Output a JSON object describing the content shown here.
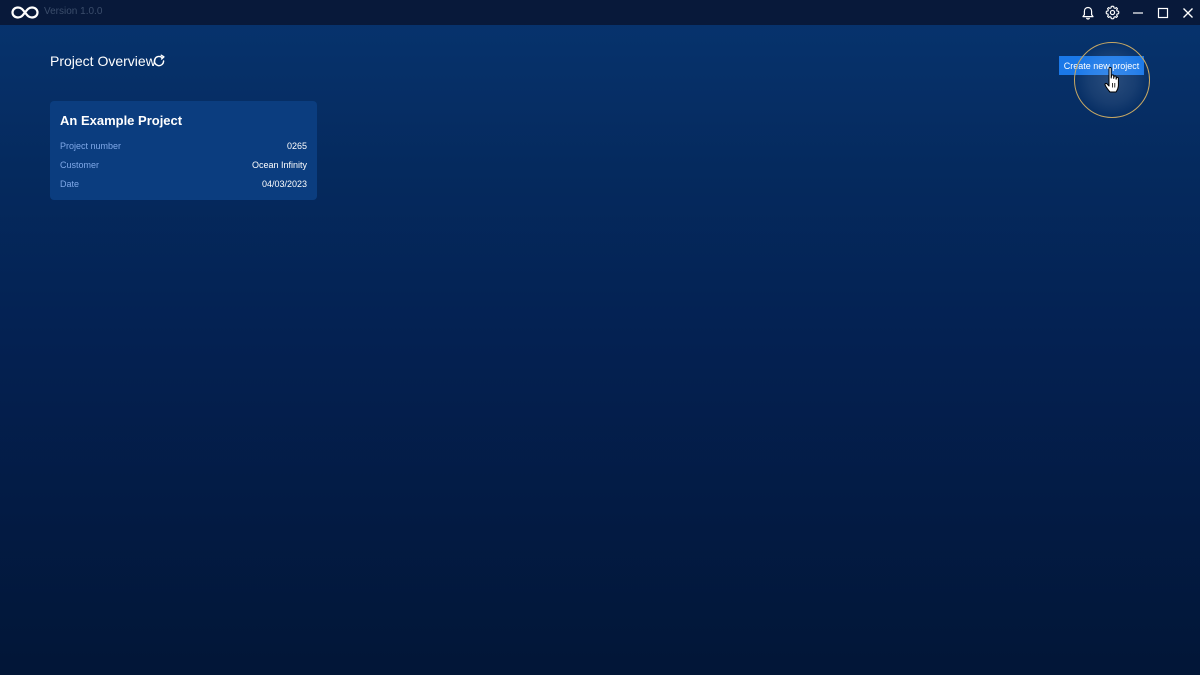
{
  "titlebar": {
    "logo_icon": "infinity-logo-icon",
    "version": "Version 1.0.0",
    "icons": [
      "bell-icon",
      "gear-icon",
      "minimize-icon",
      "maximize-icon",
      "close-icon"
    ]
  },
  "header": {
    "title": "Project Overview",
    "refresh_icon": "refresh-icon",
    "create_button_label": "Create new project"
  },
  "projects": [
    {
      "name": "An Example Project",
      "fields": [
        {
          "label": "Project number",
          "value": "0265"
        },
        {
          "label": "Customer",
          "value": "Ocean Infinity"
        },
        {
          "label": "Date",
          "value": "04/03/2023"
        }
      ]
    }
  ],
  "colors": {
    "accent": "#1a78e8",
    "card_background": "#0b3d7f",
    "label_text": "#7fa8e8",
    "titlebar": "#08193a",
    "click_ring": "#c7a864"
  }
}
